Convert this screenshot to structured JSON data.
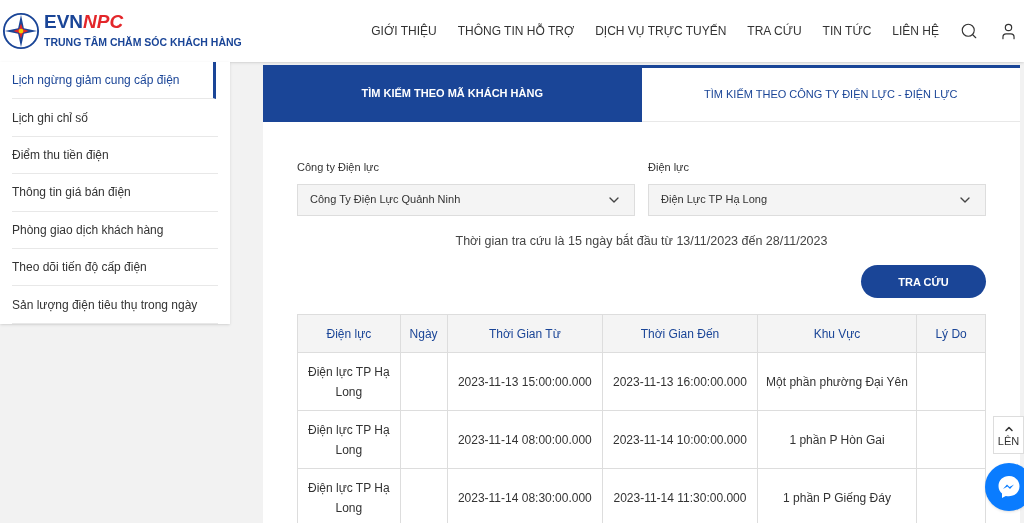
{
  "header": {
    "logo_text": "EVN",
    "logo_text_accent": "NPC",
    "subtitle": "TRUNG TÂM CHĂM SÓC KHÁCH HÀNG",
    "nav": [
      "GIỚI THIỆU",
      "THÔNG TIN HỖ TRỢ",
      "DỊCH VỤ TRỰC TUYẾN",
      "TRA CỨU",
      "TIN TỨC",
      "LIÊN HỆ"
    ]
  },
  "sidebar": {
    "items": [
      {
        "label": "Lịch ngừng giảm cung cấp điện",
        "selected": true
      },
      {
        "label": "Lịch ghi chỉ số",
        "selected": false
      },
      {
        "label": "Điểm thu tiền điện",
        "selected": false
      },
      {
        "label": "Thông tin giá bán điện",
        "selected": false
      },
      {
        "label": "Phòng giao dịch khách hàng",
        "selected": false
      },
      {
        "label": "Theo dõi tiến độ cấp điện",
        "selected": false
      },
      {
        "label": "Sản lượng điện tiêu thụ trong ngày",
        "selected": false
      }
    ]
  },
  "tabs": [
    {
      "label": "TÌM KIẾM THEO MÃ KHÁCH HÀNG",
      "selected": false
    },
    {
      "label": "TÌM KIẾM THEO CÔNG TY ĐIỆN LỰC - ĐIỆN LỰC",
      "selected": true
    }
  ],
  "filters": [
    {
      "label": "Công ty Điện lực",
      "value": "Công Ty Điện Lực Quảnh Ninh"
    },
    {
      "label": "Điện lực",
      "value": "Điện Lực TP Hạ Long"
    }
  ],
  "note": "Thời gian tra cứu là 15 ngày bắt đầu từ 13/11/2023 đến 28/11/2023",
  "search_button": "TRA CỨU",
  "table": {
    "columns": [
      "Điện lực",
      "Ngày",
      "Thời Gian Từ",
      "Thời Gian Đến",
      "Khu Vực",
      "Lý Do"
    ],
    "rows": [
      [
        "Điện lực TP Hạ Long",
        "",
        "2023-11-13 15:00:00.000",
        "2023-11-13 16:00:00.000",
        "Một phần phường Đại Yên",
        ""
      ],
      [
        "Điện lực TP Hạ Long",
        "",
        "2023-11-14 08:00:00.000",
        "2023-11-14 10:00:00.000",
        "1 phần P Hòn Gai",
        ""
      ],
      [
        "Điện lực TP Hạ Long",
        "",
        "2023-11-14 08:30:00.000",
        "2023-11-14 11:30:00.000",
        "1 phần P Giếng Đáy",
        ""
      ]
    ]
  },
  "back_to_top": "LÊN"
}
